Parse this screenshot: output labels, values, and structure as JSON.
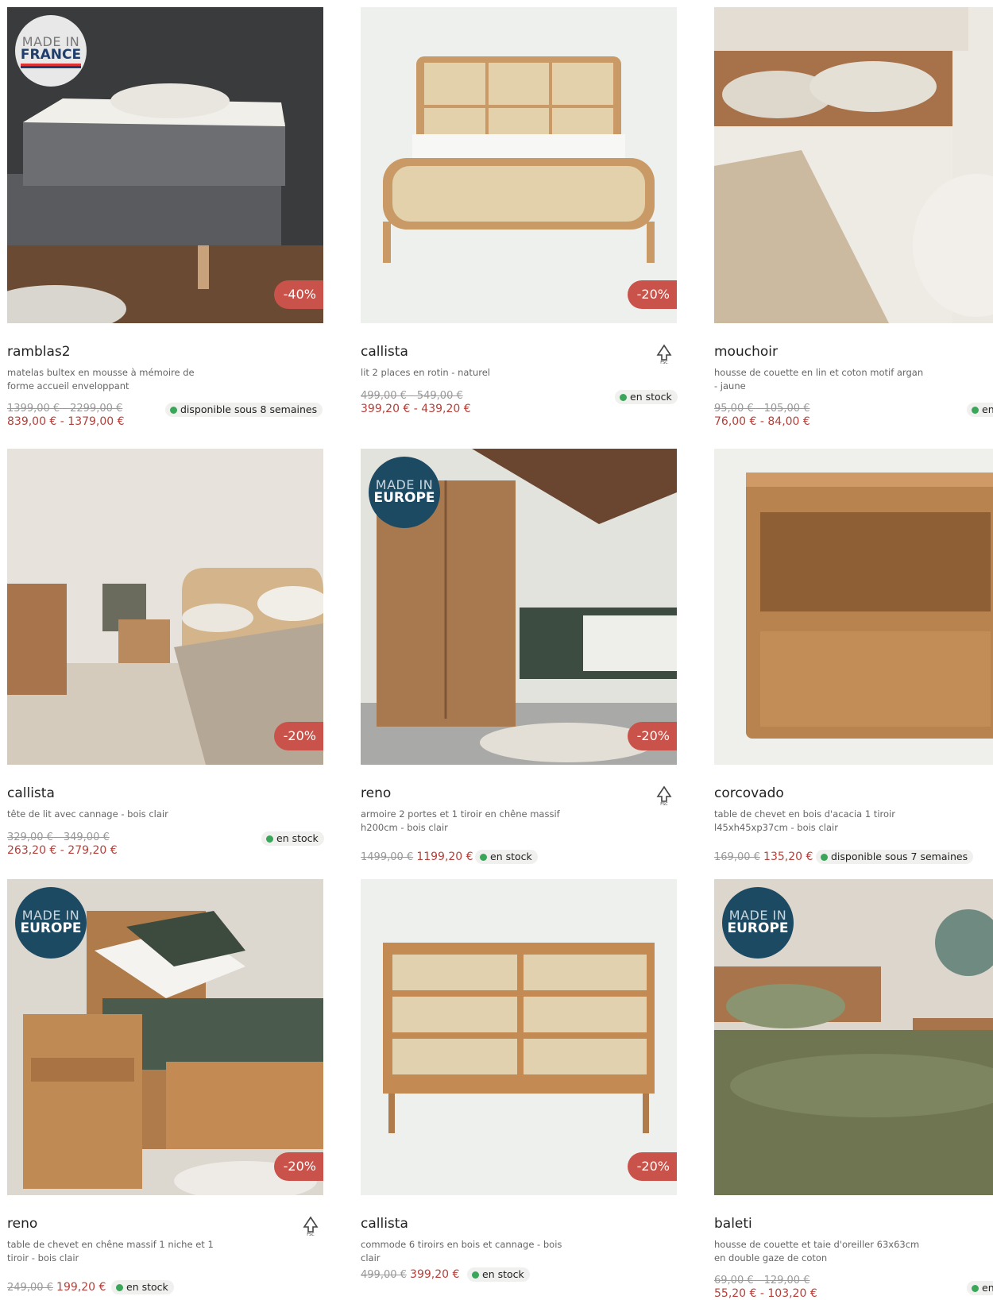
{
  "badges": {
    "made_in": "MADE IN",
    "france": "FRANCE",
    "europe": "EUROPE"
  },
  "colors": {
    "discount": "#c9534a",
    "sale_price": "#b5403a",
    "stock_dot": "#3aa65a",
    "europe_badge": "#1d4a63"
  },
  "products": [
    {
      "name": "ramblas2",
      "desc": "matelas bultex en mousse à mémoire de forme accueil enveloppant",
      "old_price": "1399,00 € - 2299,00 €",
      "new_price": "839,00 € - 1379,00 €",
      "discount": "-40%",
      "availability": "disponible sous 8 semaines",
      "badge": "france",
      "fsc": false
    },
    {
      "name": "callista",
      "desc": "lit 2 places en rotin - naturel",
      "old_price": "499,00 € - 549,00 €",
      "new_price": "399,20 € - 439,20 €",
      "discount": "-20%",
      "availability": "en stock",
      "badge": "",
      "fsc": true
    },
    {
      "name": "mouchoir",
      "desc": "housse de couette en lin et coton motif argan - jaune",
      "old_price": "95,00 € - 105,00 €",
      "new_price": "76,00 € - 84,00 €",
      "discount": "",
      "availability": "en",
      "badge": "",
      "fsc": false
    },
    {
      "name": "callista",
      "desc": "tête de lit avec cannage - bois clair",
      "old_price": "329,00 € - 349,00 €",
      "new_price": "263,20 € - 279,20 €",
      "discount": "-20%",
      "availability": "en stock",
      "badge": "",
      "fsc": false
    },
    {
      "name": "reno",
      "desc": "armoire 2 portes et 1 tiroir en chêne massif h200cm - bois clair",
      "old_price": "1499,00 €",
      "new_price": "1199,20 €",
      "discount": "-20%",
      "availability": "en stock",
      "badge": "europe",
      "fsc": true
    },
    {
      "name": "corcovado",
      "desc": "table de chevet en bois d'acacia 1 tiroir l45xh45xp37cm - bois clair",
      "old_price": "169,00 €",
      "new_price": "135,20 €",
      "discount": "",
      "availability": "disponible sous 7 semaines",
      "badge": "",
      "fsc": false
    },
    {
      "name": "reno",
      "desc": "table de chevet en chêne massif 1 niche et 1 tiroir - bois clair",
      "old_price": "249,00 €",
      "new_price": "199,20 €",
      "discount": "-20%",
      "availability": "en stock",
      "badge": "europe",
      "fsc": true
    },
    {
      "name": "callista",
      "desc": "commode 6 tiroirs en bois et cannage - bois clair",
      "old_price": "499,00 €",
      "new_price": "399,20 €",
      "discount": "-20%",
      "availability": "en stock",
      "badge": "",
      "fsc": false
    },
    {
      "name": "baleti",
      "desc": "housse de couette et taie d'oreiller 63x63cm en double gaze de coton",
      "old_price": "69,00 € - 129,00 €",
      "new_price": "55,20 € - 103,20 €",
      "discount": "",
      "availability": "en",
      "badge": "europe",
      "fsc": false
    }
  ]
}
